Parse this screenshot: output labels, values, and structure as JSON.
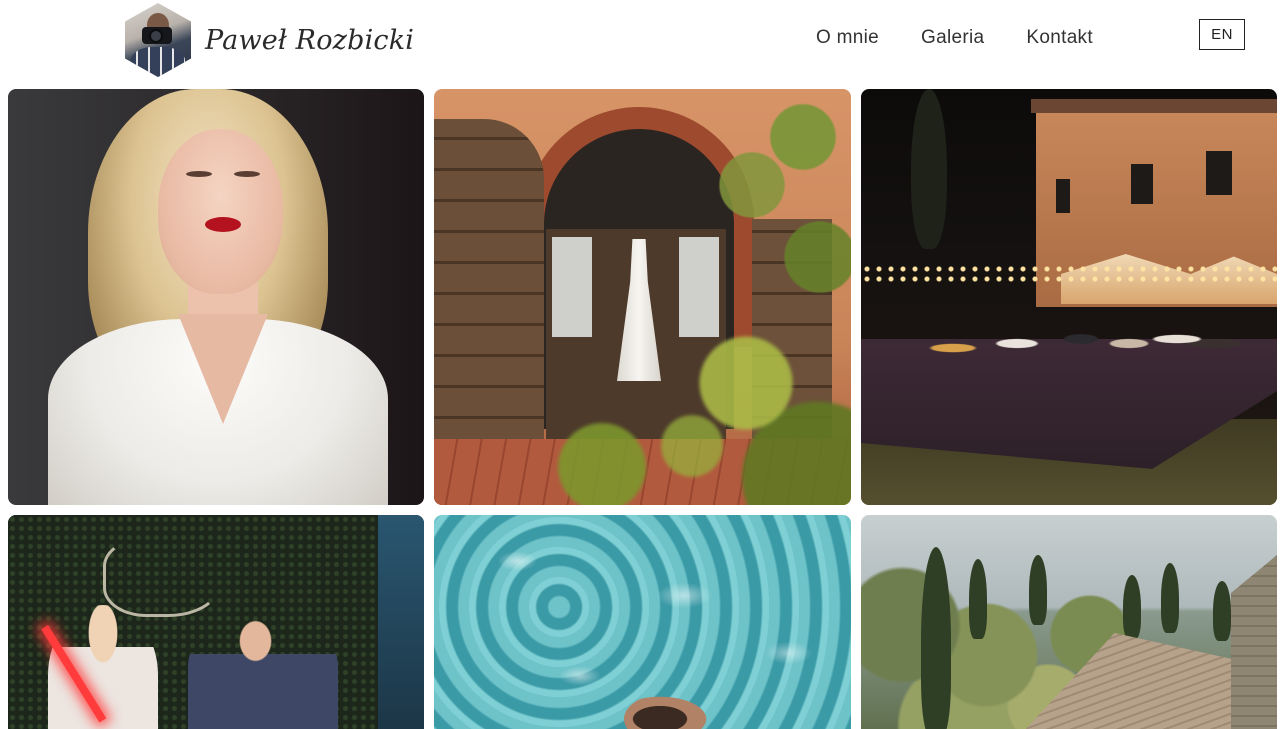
{
  "header": {
    "brand_name": "Paweł Rozbicki",
    "nav": [
      {
        "label": "O mnie"
      },
      {
        "label": "Galeria"
      },
      {
        "label": "Kontakt"
      }
    ],
    "language_label": "EN"
  },
  "gallery": {
    "photos": [
      {
        "subject": "bride-portrait"
      },
      {
        "subject": "wedding-dress-villa-door"
      },
      {
        "subject": "night-reception-dance"
      },
      {
        "subject": "neon-couple-photobooth"
      },
      {
        "subject": "swimming-pool"
      },
      {
        "subject": "lake-landscape"
      }
    ]
  },
  "colors": {
    "background": "#ffffff",
    "text": "#333333",
    "border": "#222222"
  }
}
